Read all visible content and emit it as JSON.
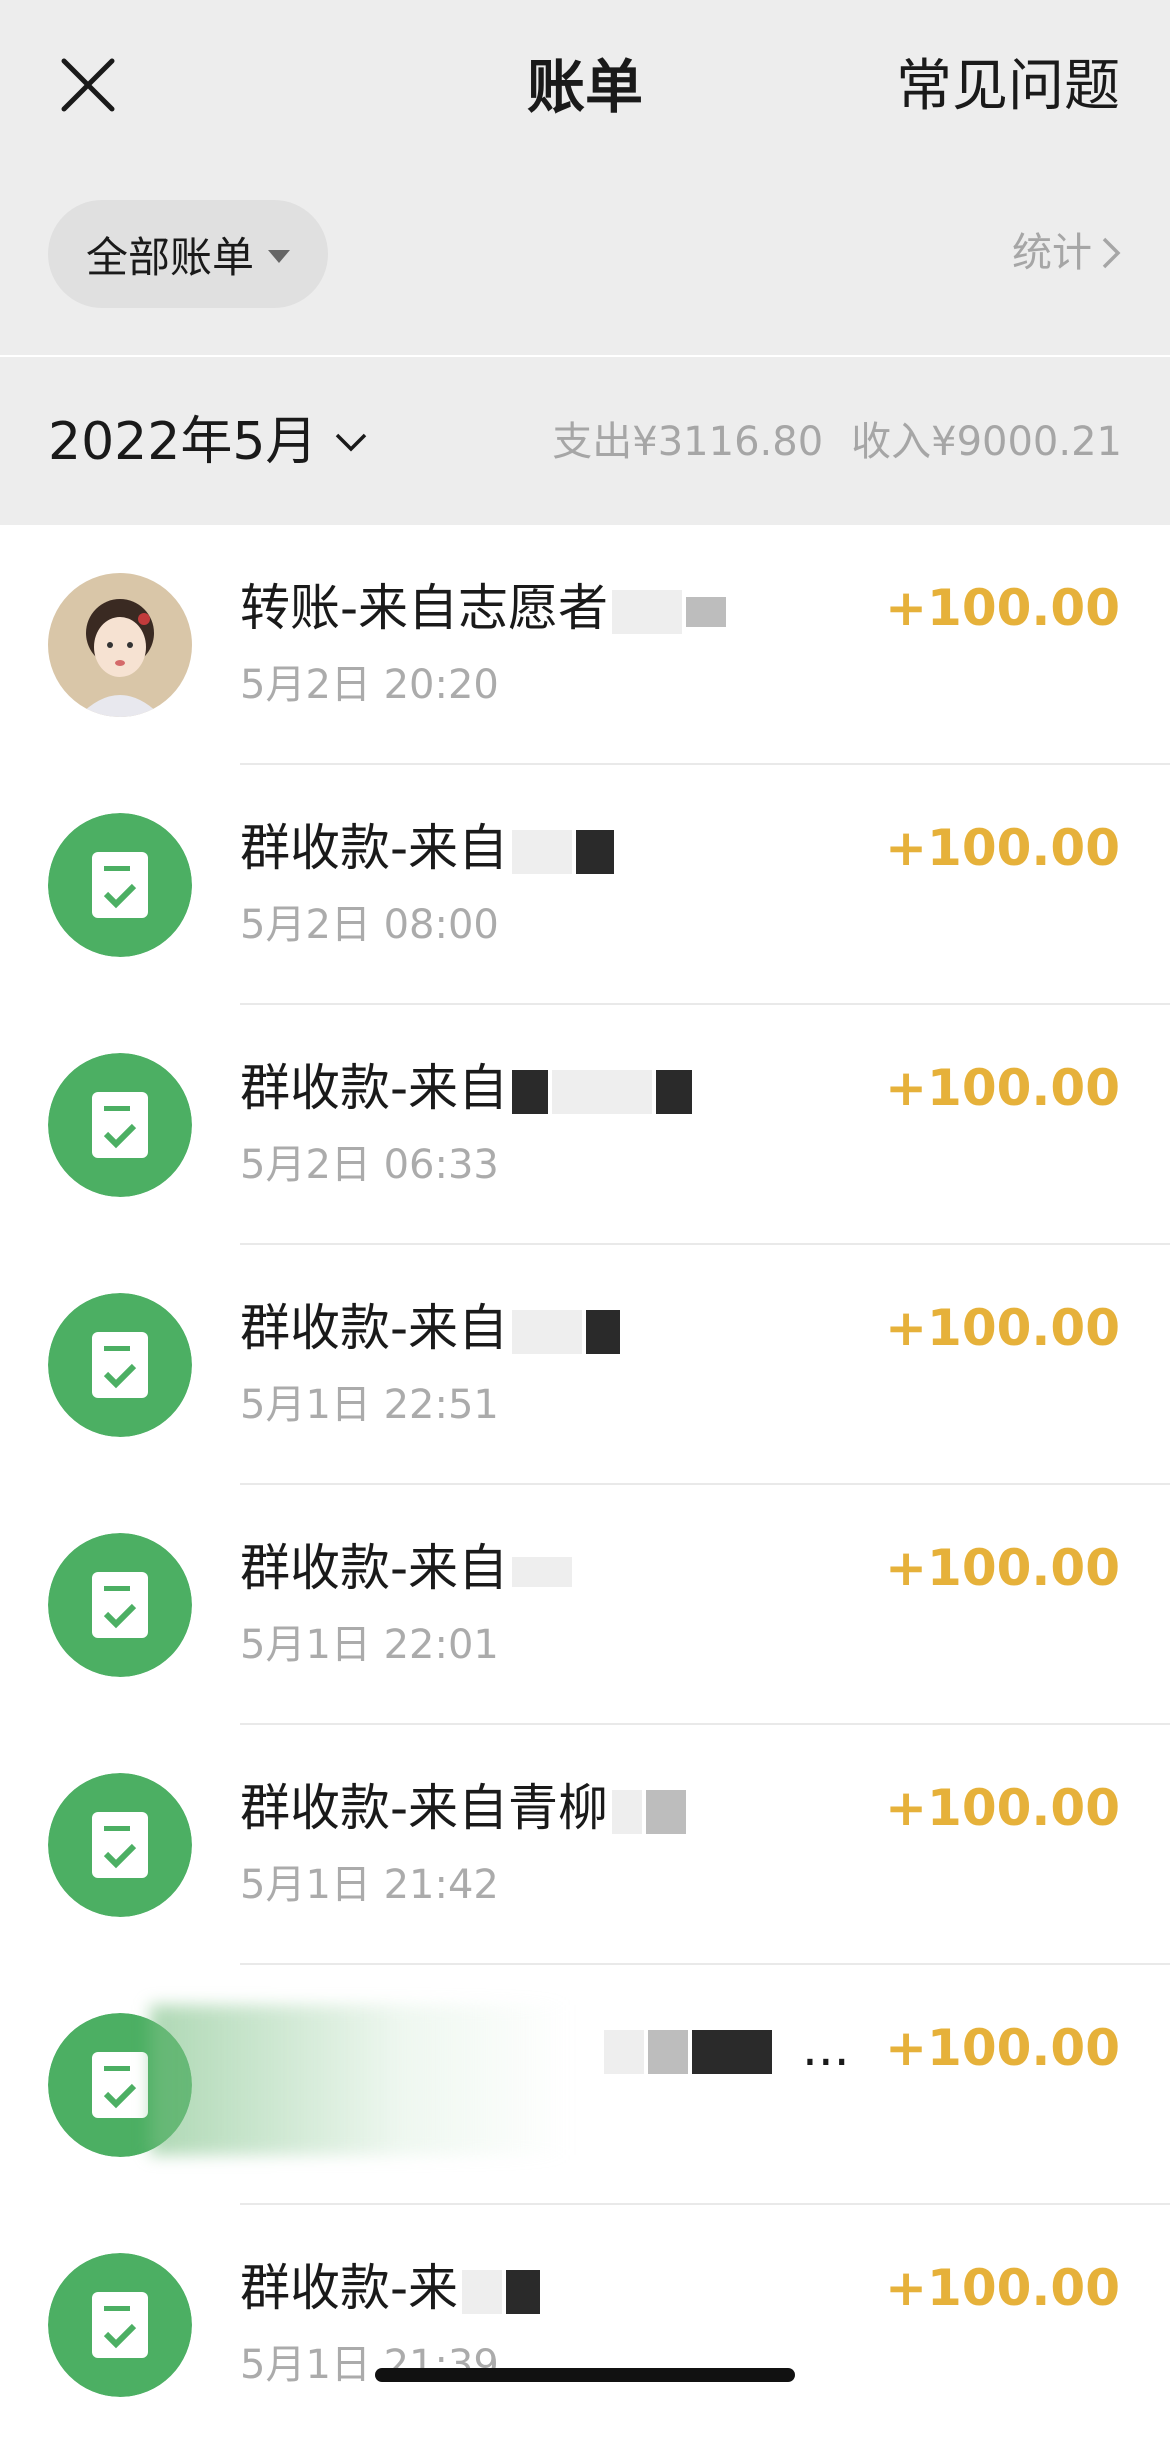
{
  "header": {
    "title": "账单",
    "faq_label": "常见问题"
  },
  "filter": {
    "label": "全部账单",
    "stats_label": "统计"
  },
  "month": {
    "label": "2022年5月",
    "expense": "支出¥3116.80",
    "income": "收入¥9000.21"
  },
  "transactions": [
    {
      "title": "转账-来自志愿者",
      "time": "5月2日 20:20",
      "amount": "+100.00",
      "icon": "avatar-portrait"
    },
    {
      "title": "群收款-来自",
      "time": "5月2日 08:00",
      "amount": "+100.00",
      "icon": "group-collect-icon"
    },
    {
      "title": "群收款-来自",
      "time": "5月2日 06:33",
      "amount": "+100.00",
      "icon": "group-collect-icon"
    },
    {
      "title": "群收款-来自",
      "time": "5月1日 22:51",
      "amount": "+100.00",
      "icon": "group-collect-icon"
    },
    {
      "title": "群收款-来自",
      "time": "5月1日 22:01",
      "amount": "+100.00",
      "icon": "group-collect-icon"
    },
    {
      "title": "群收款-来自青柳",
      "time": "5月1日 21:42",
      "amount": "+100.00",
      "icon": "group-collect-icon"
    },
    {
      "title": "...",
      "time": "",
      "amount": "+100.00",
      "icon": "group-collect-icon"
    },
    {
      "title": "群收款-来",
      "time": "5月1日 21:39",
      "amount": "+100.00",
      "icon": "group-collect-icon"
    }
  ],
  "colors": {
    "income": "#e6b13a",
    "icon_green": "#4caf63",
    "header_bg": "#ededed"
  }
}
